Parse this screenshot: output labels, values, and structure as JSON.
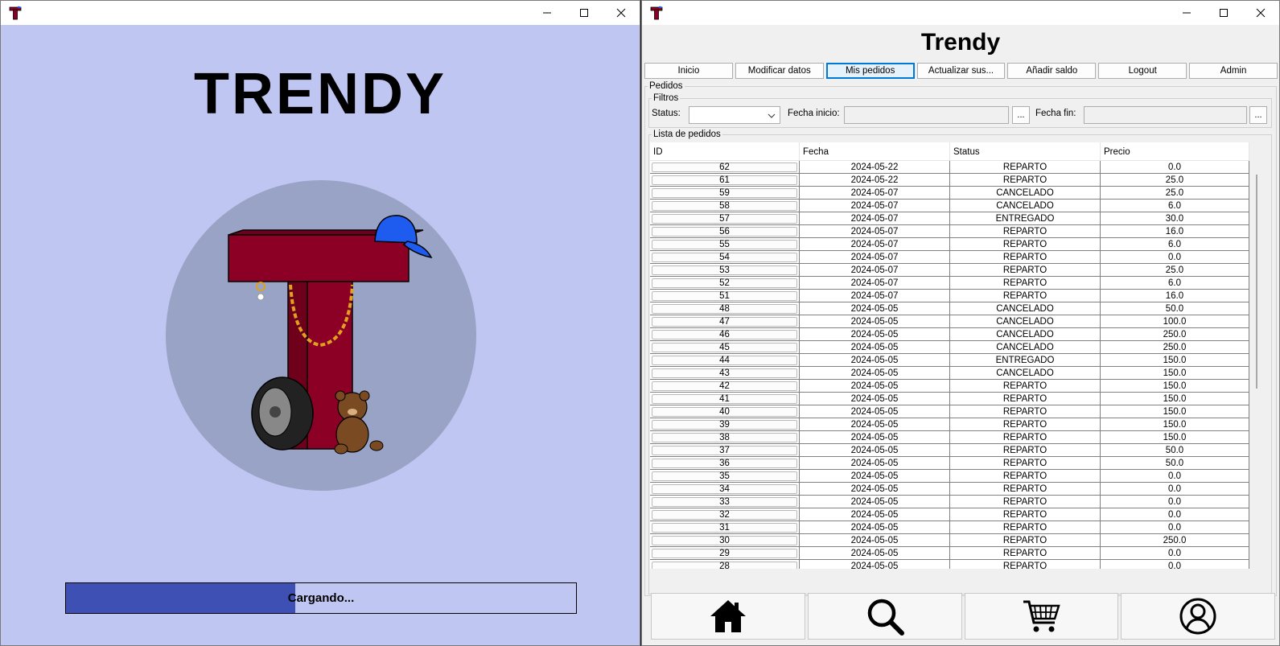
{
  "splash": {
    "title": "TRENDY",
    "progress": {
      "value": 0.45,
      "label": "Cargando..."
    },
    "colors": {
      "background": "#bfc6f2",
      "progress_fill": "#3e50b4",
      "logo_circle": "#98a3c6",
      "letter": "#8b0024"
    }
  },
  "main": {
    "title": "Trendy",
    "nav": [
      {
        "label": "Inicio",
        "active": false
      },
      {
        "label": "Modificar datos",
        "active": false
      },
      {
        "label": "Mis pedidos",
        "active": true
      },
      {
        "label": "Actualizar sus...",
        "active": false
      },
      {
        "label": "Añadir saldo",
        "active": false
      },
      {
        "label": "Logout",
        "active": false
      },
      {
        "label": "Admin",
        "active": false
      }
    ],
    "pedidos_group": "Pedidos",
    "filtros": {
      "legend": "Filtros",
      "status_label": "Status:",
      "status_value": "",
      "fecha_inicio_label": "Fecha inicio:",
      "fecha_inicio_value": "",
      "fecha_fin_label": "Fecha fin:",
      "fecha_fin_value": "",
      "picker_label": "..."
    },
    "lista": {
      "legend": "Lista de pedidos",
      "columns": [
        "ID",
        "Fecha",
        "Status",
        "Precio"
      ],
      "rows": [
        [
          "62",
          "2024-05-22",
          "REPARTO",
          "0.0"
        ],
        [
          "61",
          "2024-05-22",
          "REPARTO",
          "25.0"
        ],
        [
          "59",
          "2024-05-07",
          "CANCELADO",
          "25.0"
        ],
        [
          "58",
          "2024-05-07",
          "CANCELADO",
          "6.0"
        ],
        [
          "57",
          "2024-05-07",
          "ENTREGADO",
          "30.0"
        ],
        [
          "56",
          "2024-05-07",
          "REPARTO",
          "16.0"
        ],
        [
          "55",
          "2024-05-07",
          "REPARTO",
          "6.0"
        ],
        [
          "54",
          "2024-05-07",
          "REPARTO",
          "0.0"
        ],
        [
          "53",
          "2024-05-07",
          "REPARTO",
          "25.0"
        ],
        [
          "52",
          "2024-05-07",
          "REPARTO",
          "6.0"
        ],
        [
          "51",
          "2024-05-07",
          "REPARTO",
          "16.0"
        ],
        [
          "48",
          "2024-05-05",
          "CANCELADO",
          "50.0"
        ],
        [
          "47",
          "2024-05-05",
          "CANCELADO",
          "100.0"
        ],
        [
          "46",
          "2024-05-05",
          "CANCELADO",
          "250.0"
        ],
        [
          "45",
          "2024-05-05",
          "CANCELADO",
          "250.0"
        ],
        [
          "44",
          "2024-05-05",
          "ENTREGADO",
          "150.0"
        ],
        [
          "43",
          "2024-05-05",
          "CANCELADO",
          "150.0"
        ],
        [
          "42",
          "2024-05-05",
          "REPARTO",
          "150.0"
        ],
        [
          "41",
          "2024-05-05",
          "REPARTO",
          "150.0"
        ],
        [
          "40",
          "2024-05-05",
          "REPARTO",
          "150.0"
        ],
        [
          "39",
          "2024-05-05",
          "REPARTO",
          "150.0"
        ],
        [
          "38",
          "2024-05-05",
          "REPARTO",
          "150.0"
        ],
        [
          "37",
          "2024-05-05",
          "REPARTO",
          "50.0"
        ],
        [
          "36",
          "2024-05-05",
          "REPARTO",
          "50.0"
        ],
        [
          "35",
          "2024-05-05",
          "REPARTO",
          "0.0"
        ],
        [
          "34",
          "2024-05-05",
          "REPARTO",
          "0.0"
        ],
        [
          "33",
          "2024-05-05",
          "REPARTO",
          "0.0"
        ],
        [
          "32",
          "2024-05-05",
          "REPARTO",
          "0.0"
        ],
        [
          "31",
          "2024-05-05",
          "REPARTO",
          "0.0"
        ],
        [
          "30",
          "2024-05-05",
          "REPARTO",
          "250.0"
        ],
        [
          "29",
          "2024-05-05",
          "REPARTO",
          "0.0"
        ],
        [
          "28",
          "2024-05-05",
          "REPARTO",
          "0.0"
        ]
      ]
    },
    "bottom_nav": [
      {
        "icon": "home-icon"
      },
      {
        "icon": "search-icon"
      },
      {
        "icon": "cart-icon"
      },
      {
        "icon": "user-icon"
      }
    ],
    "colors": {
      "active_tab_border": "#0078d7",
      "active_tab_bg": "#e5f1fb"
    }
  }
}
